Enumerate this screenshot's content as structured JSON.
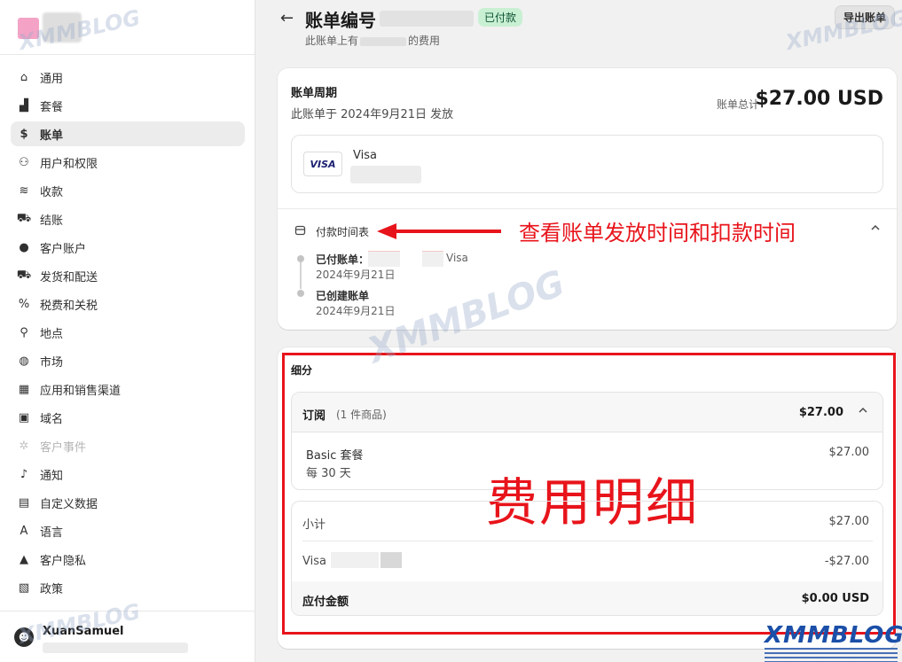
{
  "sidebar": {
    "items": [
      {
        "icon": "store-icon",
        "label": "通用",
        "glyph": "⌂"
      },
      {
        "icon": "plan-icon",
        "label": "套餐",
        "glyph": "▟"
      },
      {
        "icon": "billing-icon",
        "label": "账单",
        "glyph": "$"
      },
      {
        "icon": "users-icon",
        "label": "用户和权限",
        "glyph": "⚇"
      },
      {
        "icon": "payments-icon",
        "label": "收款",
        "glyph": "≋"
      },
      {
        "icon": "checkout-icon",
        "label": "结账",
        "glyph": "⛟"
      },
      {
        "icon": "customer-icon",
        "label": "客户账户",
        "glyph": "●"
      },
      {
        "icon": "shipping-icon",
        "label": "发货和配送",
        "glyph": "⛟"
      },
      {
        "icon": "taxes-icon",
        "label": "税费和关税",
        "glyph": "%"
      },
      {
        "icon": "location-icon",
        "label": "地点",
        "glyph": "⚲"
      },
      {
        "icon": "markets-icon",
        "label": "市场",
        "glyph": "◍"
      },
      {
        "icon": "apps-icon",
        "label": "应用和销售渠道",
        "glyph": "▦"
      },
      {
        "icon": "domains-icon",
        "label": "域名",
        "glyph": "▣"
      },
      {
        "icon": "customer-events-icon",
        "label": "客户事件",
        "glyph": "✲"
      },
      {
        "icon": "notifications-icon",
        "label": "通知",
        "glyph": "♪"
      },
      {
        "icon": "metafields-icon",
        "label": "自定义数据",
        "glyph": "▤"
      },
      {
        "icon": "languages-icon",
        "label": "语言",
        "glyph": "A"
      },
      {
        "icon": "privacy-icon",
        "label": "客户隐私",
        "glyph": "▲"
      },
      {
        "icon": "policies-icon",
        "label": "政策",
        "glyph": "▧"
      }
    ],
    "user": {
      "name": "XuanSamuel",
      "avatar_glyph": "☻"
    }
  },
  "header": {
    "back_glyph": "←",
    "title": "账单编号",
    "badge": "已付款",
    "subtitle_prefix": "此账单上有",
    "subtitle_suffix": "的费用",
    "export_label": "导出账单"
  },
  "bill": {
    "period_title": "账单周期",
    "issued_text": "此账单于 2024年9月21日 发放",
    "total_label": "账单总计",
    "total_amount": "$27.00 USD",
    "payment_method": {
      "brand_logo": "VISA",
      "name": "Visa"
    }
  },
  "schedule": {
    "title": "付款时间表",
    "events": [
      {
        "title": "已付账单：",
        "date": "2024年9月21日",
        "method": "Visa"
      },
      {
        "title": "已创建账单",
        "date": "2024年9月21日"
      }
    ]
  },
  "annotations": {
    "schedule_note": "查看账单发放时间和扣款时间",
    "details_note": "费用明细",
    "arrow_color": "#e8141b"
  },
  "breakdown": {
    "title": "细分",
    "subscription": {
      "name": "订阅",
      "count": "(1 件商品)",
      "amount": "$27.00",
      "plan_name": "Basic 套餐",
      "plan_cycle": "每 30 天",
      "plan_amount": "$27.00"
    },
    "summary": {
      "subtotal_label": "小计",
      "subtotal_value": "$27.00",
      "payment_label": "Visa",
      "payment_value": "-$27.00",
      "due_label": "应付金额",
      "due_value": "$0.00 USD"
    }
  },
  "watermark": {
    "text": "XMMBLOG"
  },
  "colors": {
    "badge_bg": "#c9f0d3",
    "badge_fg": "#0c5132",
    "annotation_red": "#e8141b",
    "watermark_blue": "#1b4fa8"
  }
}
